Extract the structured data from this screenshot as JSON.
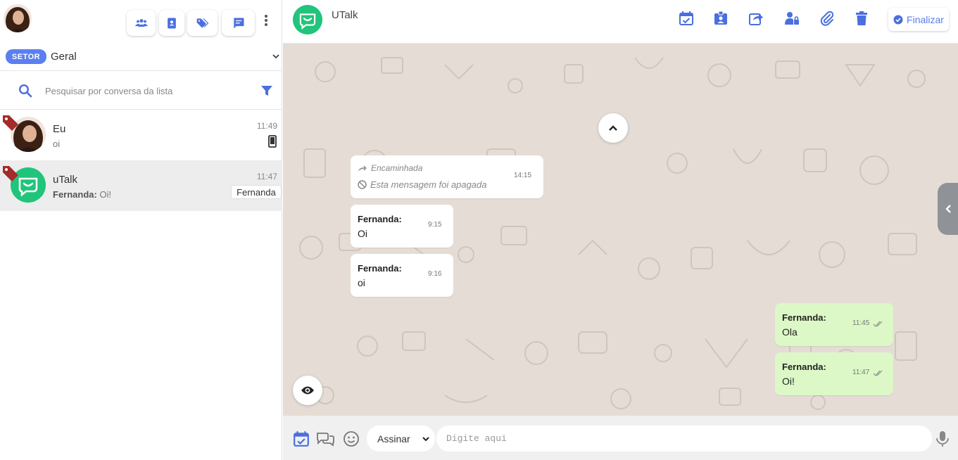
{
  "sidebar": {
    "setor": {
      "badge": "SETOR",
      "value": "Geral"
    },
    "search": {
      "placeholder": "Pesquisar por conversa da lista"
    },
    "conversations": [
      {
        "name": "Eu",
        "preview": "oi",
        "time": "11:49"
      },
      {
        "name": "uTalk",
        "preview_sender": "Fernanda:",
        "preview_text": "Oi!",
        "time": "11:47",
        "agent": "Fernanda"
      }
    ]
  },
  "chat": {
    "title": "UTalk",
    "finalize_label": "Finalizar",
    "messages": [
      {
        "forwarded_label": "Encaminhada",
        "deleted_text": "Esta mensagem foi apagada",
        "time": "14:15"
      },
      {
        "sender": "Fernanda:",
        "text": "Oi",
        "time": "9:15"
      },
      {
        "sender": "Fernanda:",
        "text": "oi",
        "time": "9:16"
      },
      {
        "sender": "Fernanda:",
        "text": "Ola",
        "time": "11:45"
      },
      {
        "sender": "Fernanda:",
        "text": "Oi!",
        "time": "11:47"
      }
    ],
    "composer": {
      "sign_value": "Assinar",
      "placeholder": "Digite aqui"
    }
  },
  "colors": {
    "accent": "#5b7ff0",
    "icon_blue": "#4a6fe0",
    "brand_green": "#21c47b",
    "outgoing_bubble": "#dcf8c6",
    "chat_background": "#e5ddd5",
    "tag_red": "#a52a2a"
  },
  "icons": [
    "users-icon",
    "contact-card-icon",
    "tags-icon",
    "message-icon",
    "kebab-menu-icon",
    "search-icon",
    "filter-icon",
    "tag-icon",
    "mobile-icon",
    "calendar-check-icon",
    "badge-icon",
    "share-icon",
    "user-lock-icon",
    "paperclip-icon",
    "trash-icon",
    "check-circle-icon",
    "chevron-up-icon",
    "eye-icon",
    "chevron-left-icon",
    "forward-icon",
    "ban-icon",
    "double-check-icon",
    "chat-bubbles-icon",
    "smile-icon",
    "microphone-icon"
  ]
}
